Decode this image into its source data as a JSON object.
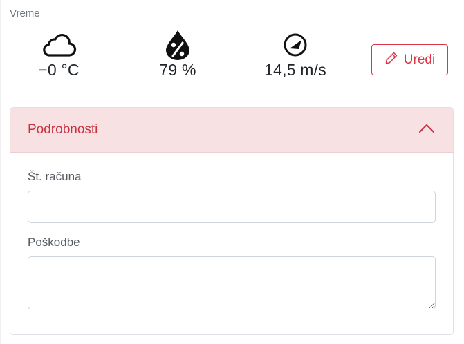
{
  "weather": {
    "label": "Vreme",
    "items": [
      {
        "icon": "cloud-icon",
        "value": "−0 °C"
      },
      {
        "icon": "humidity-icon",
        "value": "79 %"
      },
      {
        "icon": "wind-direction-icon",
        "value": "14,5 m/s"
      }
    ],
    "edit_label": "Uredi",
    "edit_icon": "pencil-icon"
  },
  "details": {
    "title": "Podrobnosti",
    "toggle_icon": "chevron-up-icon",
    "invoice_label": "Št. računa",
    "invoice_value": "",
    "damage_label": "Poškodbe",
    "damage_value": ""
  },
  "colors": {
    "accent": "#dc3545",
    "header_bg": "#f8e1e3",
    "muted_text": "#6c757d"
  }
}
